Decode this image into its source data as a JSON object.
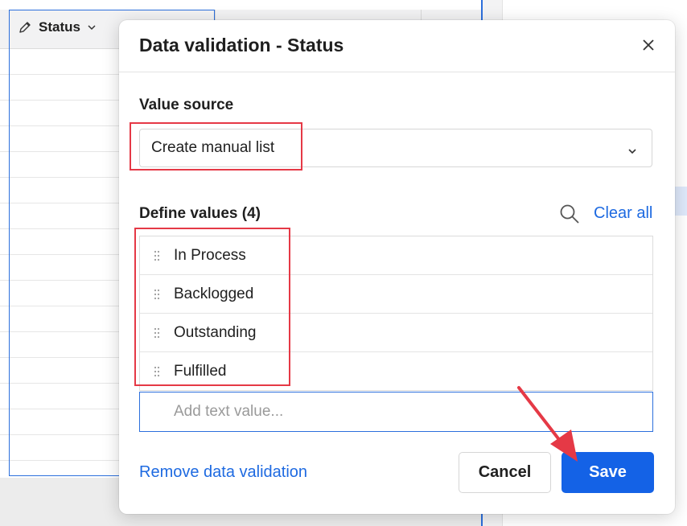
{
  "spreadsheet": {
    "column_header_label": "Status"
  },
  "dialog": {
    "title": "Data validation - Status",
    "value_source": {
      "label": "Value source",
      "selected": "Create manual list"
    },
    "define_values": {
      "label": "Define values (4)",
      "clear_all": "Clear all",
      "items": [
        {
          "label": "In Process"
        },
        {
          "label": "Backlogged"
        },
        {
          "label": "Outstanding"
        },
        {
          "label": "Fulfilled"
        }
      ],
      "add_placeholder": "Add text value..."
    },
    "remove_link": "Remove data validation",
    "cancel_label": "Cancel",
    "save_label": "Save"
  },
  "colors": {
    "accent": "#1462e6",
    "link": "#1e6ae1",
    "annotation": "#e53946"
  },
  "icons": [
    "pencil-icon",
    "chevron-down-icon",
    "close-icon",
    "search-icon",
    "drag-handle-icon"
  ]
}
